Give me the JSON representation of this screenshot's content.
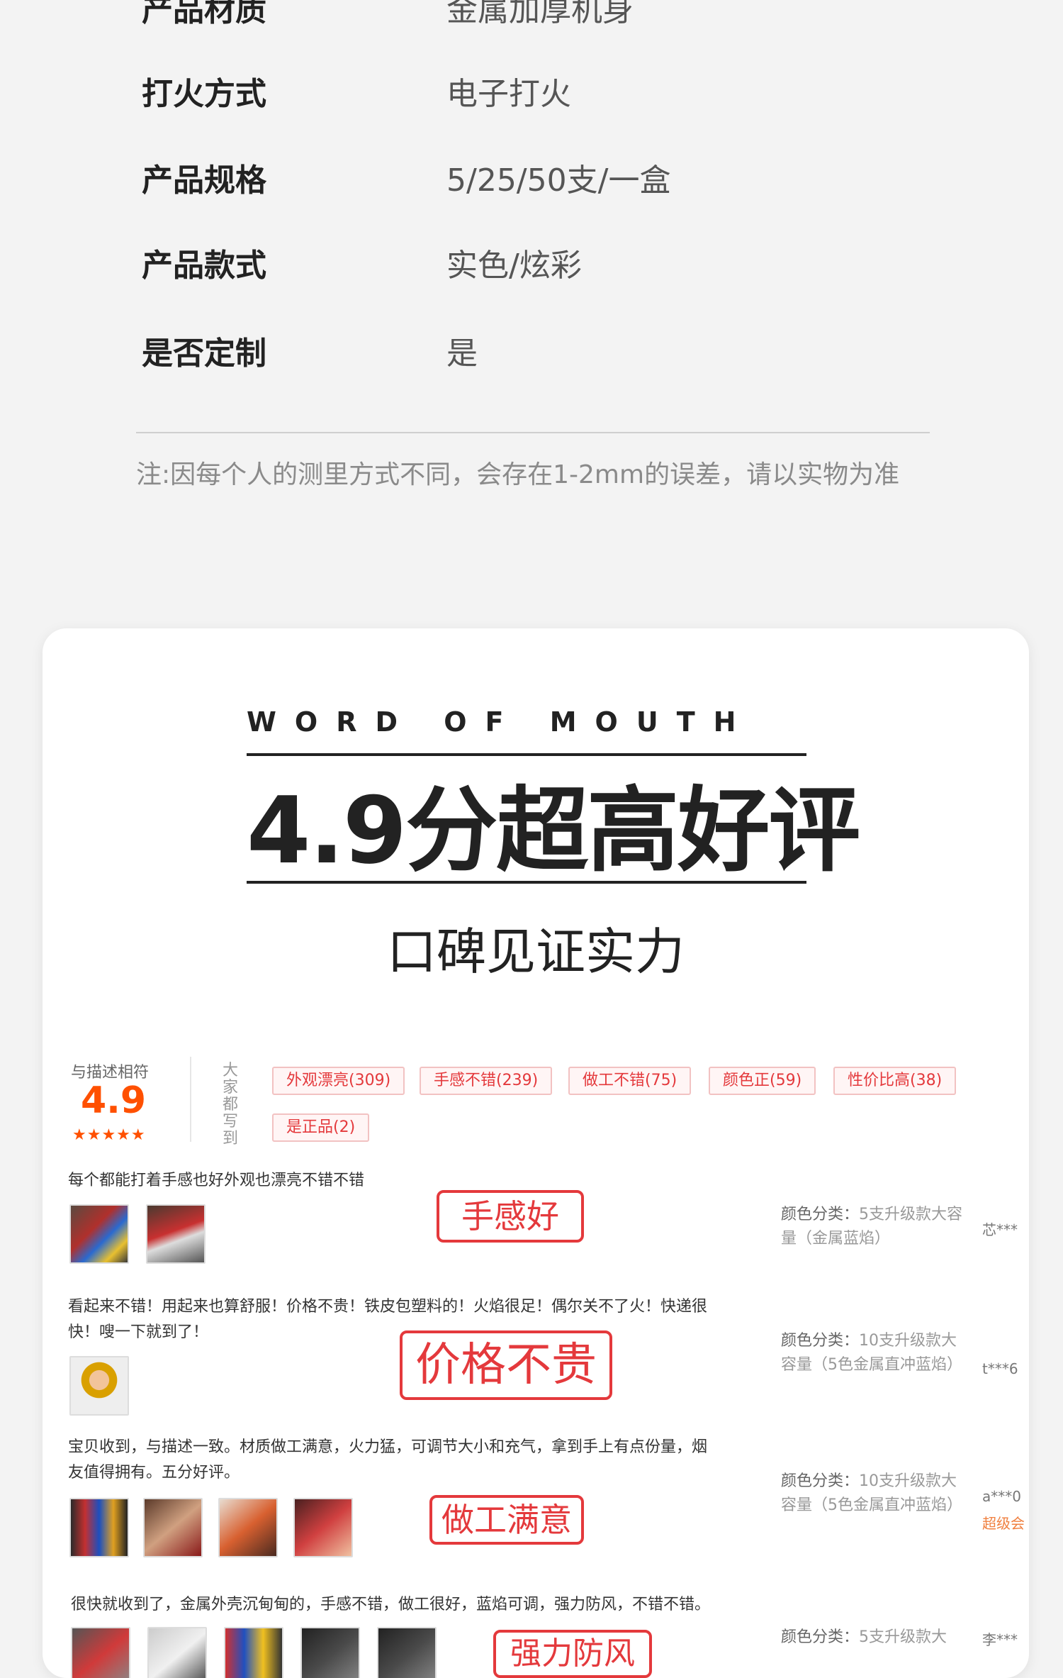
{
  "specs": [
    {
      "label": "产品材质",
      "value": "金属加厚机身"
    },
    {
      "label": "打火方式",
      "value": "电子打火"
    },
    {
      "label": "产品规格",
      "value": "5/25/50支/一盒"
    },
    {
      "label": "产品款式",
      "value": "实色/炫彩"
    },
    {
      "label": "是否定制",
      "value": "是"
    }
  ],
  "note": "注:因每个人的测里方式不同，会存在1-2mm的误差，请以实物为准",
  "banner": {
    "eyebrow": "WORD OF MOUTH",
    "headline": "4.9分超高好评",
    "subtitle": "口碑见证实力"
  },
  "rating": {
    "label": "与描述相符",
    "score": "4.9",
    "stars": "★★★★★",
    "vertical_label": "大家都写到"
  },
  "tags": [
    "外观漂亮(309)",
    "手感不错(239)",
    "做工不错(75)",
    "颜色正(59)",
    "性价比高(38)",
    "是正品(2)"
  ],
  "reviews": [
    {
      "text": "每个都能打着手感也好外观也漂亮不错不错",
      "stamp": "手感好",
      "variant_key": "颜色分类：",
      "variant_value": "5支升级款大容量（金属蓝焰）",
      "user": "芯***",
      "user_level": ""
    },
    {
      "text": "看起来不错！用起来也算舒服！价格不贵！铁皮包塑料的！火焰很足！偶尔关不了火！快递很",
      "text2": "快！嗖一下就到了！",
      "stamp": "价格不贵",
      "variant_key": "颜色分类：",
      "variant_value": "10支升级款大容量（5色金属直冲蓝焰）",
      "user": "t***6",
      "user_level": ""
    },
    {
      "text": "宝贝收到，与描述一致。材质做工满意，火力猛，可调节大小和充气，拿到手上有点份量，烟",
      "text2": "友值得拥有。五分好评。",
      "stamp": "做工满意",
      "variant_key": "颜色分类：",
      "variant_value": "10支升级款大容量（5色金属直冲蓝焰）",
      "user": "a***0",
      "user_level": "超级会"
    },
    {
      "text": "很快就收到了，金属外壳沉甸甸的，手感不错，做工很好，蓝焰可调，强力防风，不错不错。",
      "stamp": "强力防风",
      "variant_key": "颜色分类：",
      "variant_value": "5支升级款大",
      "user": "李***",
      "user_level": ""
    }
  ]
}
